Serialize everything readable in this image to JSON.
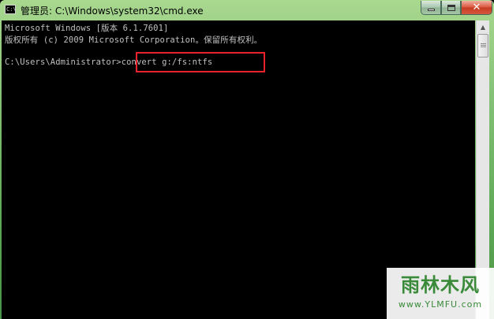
{
  "window": {
    "title": "管理员: C:\\Windows\\system32\\cmd.exe",
    "icon": "C:\\",
    "controls": {
      "minimize": "minimize",
      "maximize": "maximize",
      "close": "✕"
    }
  },
  "console": {
    "line1": "Microsoft Windows [版本 6.1.7601]",
    "line2": "版权所有 (c) 2009 Microsoft Corporation。保留所有权利。",
    "prompt": "C:\\Users\\Administrator>",
    "command": "convert g:/fs:ntfs"
  },
  "highlight_color": "#e8212a",
  "scrollbar": {
    "up_arrow": "▲"
  },
  "watermark": {
    "logo": "雨林木风",
    "url": "www.YLMFU.com"
  }
}
